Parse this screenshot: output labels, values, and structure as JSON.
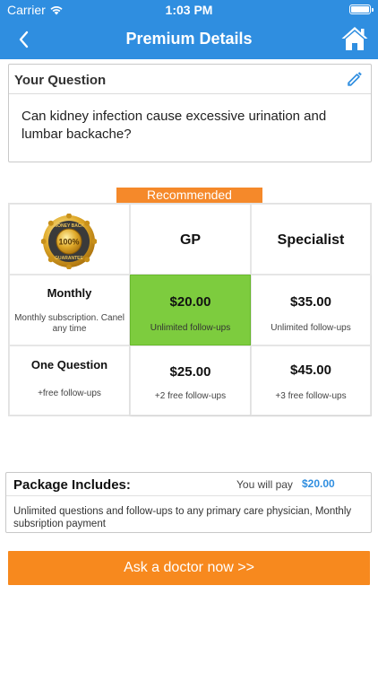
{
  "status": {
    "carrier": "Carrier",
    "time": "1:03 PM",
    "battery_level": 1.0
  },
  "nav": {
    "title": "Premium Details",
    "back_icon": "chevron-left-icon",
    "home_icon": "home-icon"
  },
  "question": {
    "header": "Your Question",
    "text": "Can kidney infection cause excessive urination and lumbar backache?",
    "edit_icon": "pencil-icon"
  },
  "pricing": {
    "recommended_label": "Recommended",
    "columns": [
      "GP",
      "Specialist"
    ],
    "badge": {
      "top_text": "MONEY BACK",
      "center_text": "100%",
      "bottom_text": "GUARANTEE"
    },
    "rows": [
      {
        "label": "Monthly",
        "sub": "Monthly subscription. Canel any time",
        "gp_price": "$20.00",
        "gp_sub": "Unlimited follow-ups",
        "spec_price": "$35.00",
        "spec_sub": "Unlimited follow-ups"
      },
      {
        "label": "One Question",
        "sub": "+free follow-ups",
        "gp_price": "$25.00",
        "gp_sub": "+2 free follow-ups",
        "spec_price": "$45.00",
        "spec_sub": "+3 free follow-ups"
      }
    ],
    "selected": "Monthly GP",
    "colors": {
      "selected": "#7dcc3e",
      "recommended": "#f5892a"
    }
  },
  "package": {
    "title": "Package Includes:",
    "pay_label": "You will pay",
    "pay_amount": "$20.00",
    "description": "Unlimited questions and follow-ups to any primary care physician, Monthly subsription payment"
  },
  "cta": {
    "label": "Ask a doctor now >>"
  },
  "colors": {
    "brand_blue": "#2f8ee0",
    "accent_orange": "#f7891e"
  }
}
